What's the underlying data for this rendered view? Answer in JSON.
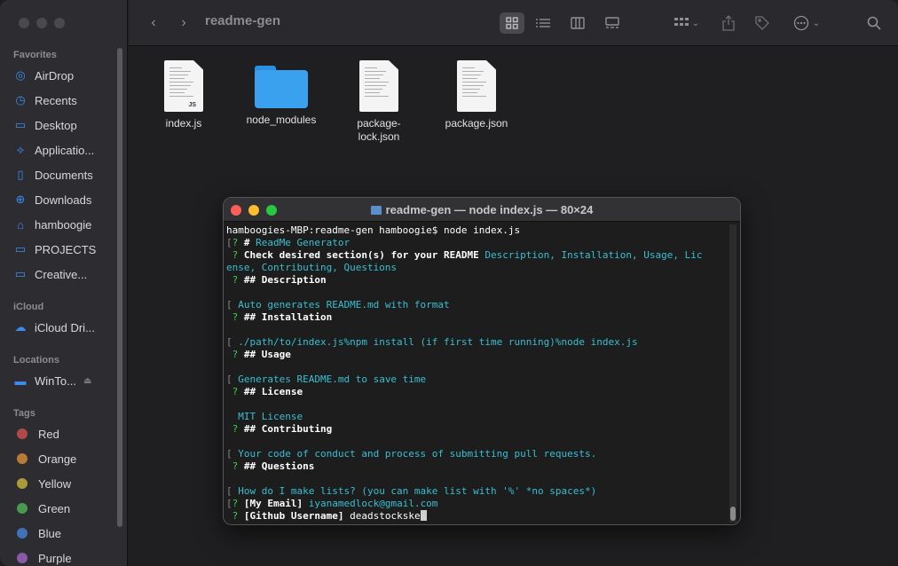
{
  "finder": {
    "title": "readme-gen",
    "sidebar": {
      "favorites_header": "Favorites",
      "favorites": [
        {
          "label": "AirDrop",
          "icon": "airdrop-icon",
          "glyph": "◎"
        },
        {
          "label": "Recents",
          "icon": "clock-icon",
          "glyph": "◷"
        },
        {
          "label": "Desktop",
          "icon": "desktop-icon",
          "glyph": "▭"
        },
        {
          "label": "Applicatio...",
          "icon": "applications-icon",
          "glyph": "⟡"
        },
        {
          "label": "Documents",
          "icon": "document-icon",
          "glyph": "▯"
        },
        {
          "label": "Downloads",
          "icon": "download-icon",
          "glyph": "⊕"
        },
        {
          "label": "hamboogie",
          "icon": "home-icon",
          "glyph": "⌂"
        },
        {
          "label": "PROJECTS",
          "icon": "folder-icon",
          "glyph": "▭"
        },
        {
          "label": "Creative...",
          "icon": "folder-icon",
          "glyph": "▭"
        }
      ],
      "icloud_header": "iCloud",
      "icloud": [
        {
          "label": "iCloud Dri...",
          "icon": "cloud-icon",
          "glyph": "☁"
        }
      ],
      "locations_header": "Locations",
      "locations": [
        {
          "label": "WinTo...",
          "icon": "drive-icon",
          "glyph": "▬",
          "eject": "⏏"
        }
      ],
      "tags_header": "Tags",
      "tags": [
        {
          "label": "Red",
          "color": "#b04a4a"
        },
        {
          "label": "Orange",
          "color": "#b97a36"
        },
        {
          "label": "Yellow",
          "color": "#ab9a3a"
        },
        {
          "label": "Green",
          "color": "#4a9a4e"
        },
        {
          "label": "Blue",
          "color": "#3f72b8"
        },
        {
          "label": "Purple",
          "color": "#8a5aa8"
        }
      ]
    },
    "files": [
      {
        "label": "index.js",
        "type": "doc",
        "ext": "JS"
      },
      {
        "label": "node_modules",
        "type": "folder"
      },
      {
        "label": "package-\nlock.json",
        "type": "doc",
        "ext": ""
      },
      {
        "label": "package.json",
        "type": "doc",
        "ext": ""
      }
    ]
  },
  "terminal": {
    "title": "readme-gen — node index.js — 80×24",
    "lines": [
      [
        {
          "t": "hamboogies-MBP:readme-gen hamboogie$ node index.js"
        }
      ],
      [
        {
          "t": "[",
          "c": "dim"
        },
        {
          "t": "? ",
          "c": "gr"
        },
        {
          "t": "# ",
          "c": "b"
        },
        {
          "t": "ReadMe Generator",
          "c": "cy"
        }
      ],
      [
        {
          "t": " ? ",
          "c": "gr"
        },
        {
          "t": "Check desired section(s) for your README ",
          "c": "b"
        },
        {
          "t": "Description, Installation, Usage, Lic",
          "c": "cy"
        }
      ],
      [
        {
          "t": "ense, Contributing, Questions",
          "c": "cy"
        }
      ],
      [
        {
          "t": " ? ",
          "c": "gr"
        },
        {
          "t": "## Description",
          "c": "b"
        }
      ],
      [
        {
          "t": ""
        }
      ],
      [
        {
          "t": "[ ",
          "c": "dim"
        },
        {
          "t": "Auto generates README.md with format",
          "c": "cy"
        }
      ],
      [
        {
          "t": " ? ",
          "c": "gr"
        },
        {
          "t": "## Installation",
          "c": "b"
        }
      ],
      [
        {
          "t": ""
        }
      ],
      [
        {
          "t": "[ ",
          "c": "dim"
        },
        {
          "t": "./path/to/index.js%npm install (if first time running)%node index.js",
          "c": "cy"
        }
      ],
      [
        {
          "t": " ? ",
          "c": "gr"
        },
        {
          "t": "## Usage",
          "c": "b"
        }
      ],
      [
        {
          "t": ""
        }
      ],
      [
        {
          "t": "[ ",
          "c": "dim"
        },
        {
          "t": "Generates README.md to save time",
          "c": "cy"
        }
      ],
      [
        {
          "t": " ? ",
          "c": "gr"
        },
        {
          "t": "## License",
          "c": "b"
        }
      ],
      [
        {
          "t": ""
        }
      ],
      [
        {
          "t": "  "
        },
        {
          "t": "MIT License",
          "c": "cy"
        }
      ],
      [
        {
          "t": " ? ",
          "c": "gr"
        },
        {
          "t": "## Contributing",
          "c": "b"
        }
      ],
      [
        {
          "t": ""
        }
      ],
      [
        {
          "t": "[ ",
          "c": "dim"
        },
        {
          "t": "Your code of conduct and process of submitting pull requests.",
          "c": "cy"
        }
      ],
      [
        {
          "t": " ? ",
          "c": "gr"
        },
        {
          "t": "## Questions",
          "c": "b"
        }
      ],
      [
        {
          "t": ""
        }
      ],
      [
        {
          "t": "[ ",
          "c": "dim"
        },
        {
          "t": "How do I make lists? (you can make list with '%' *no spaces*)",
          "c": "cy"
        }
      ],
      [
        {
          "t": "[",
          "c": "dim"
        },
        {
          "t": "? ",
          "c": "gr"
        },
        {
          "t": "[My Email] ",
          "c": "b"
        },
        {
          "t": "iyanamedlock@gmail.com",
          "c": "cy"
        }
      ],
      [
        {
          "t": " ? ",
          "c": "gr"
        },
        {
          "t": "[Github Username] ",
          "c": "b"
        },
        {
          "t": "deadstockske"
        },
        {
          "t": "",
          "cursor": true
        }
      ]
    ]
  }
}
